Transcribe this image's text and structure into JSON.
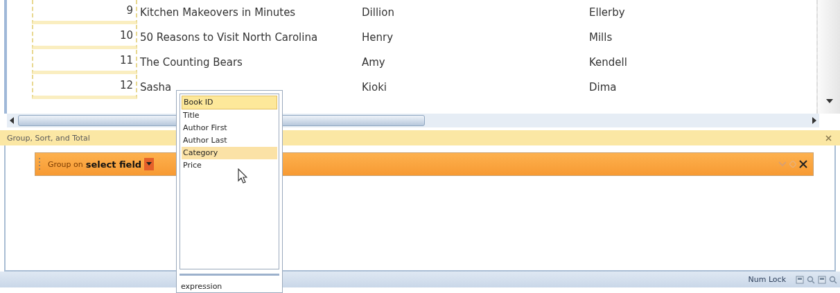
{
  "table": {
    "rows": [
      {
        "id": "9",
        "title": "Kitchen Makeovers in Minutes",
        "author_first": "Dillion",
        "author_last": "Ellerby"
      },
      {
        "id": "10",
        "title": "50 Reasons to Visit North Carolina",
        "author_first": "Henry",
        "author_last": "Mills"
      },
      {
        "id": "11",
        "title": "The Counting Bears",
        "author_first": "Amy",
        "author_last": "Kendell"
      },
      {
        "id": "12",
        "title": "Sasha",
        "author_first": "Kioki",
        "author_last": "Dima"
      }
    ]
  },
  "group_pane": {
    "title": "Group, Sort, and Total",
    "group_row": {
      "label": "Group on",
      "field": "select field"
    }
  },
  "field_list": {
    "items": [
      {
        "label": "Book ID",
        "selected": true,
        "highlighted": false
      },
      {
        "label": "Title",
        "selected": false,
        "highlighted": false
      },
      {
        "label": "Author First",
        "selected": false,
        "highlighted": false
      },
      {
        "label": "Author Last",
        "selected": false,
        "highlighted": false
      },
      {
        "label": "Category",
        "selected": false,
        "highlighted": true
      },
      {
        "label": "Price",
        "selected": false,
        "highlighted": false
      }
    ],
    "footer": "expression"
  },
  "status_bar": {
    "text": "Num Lock"
  }
}
